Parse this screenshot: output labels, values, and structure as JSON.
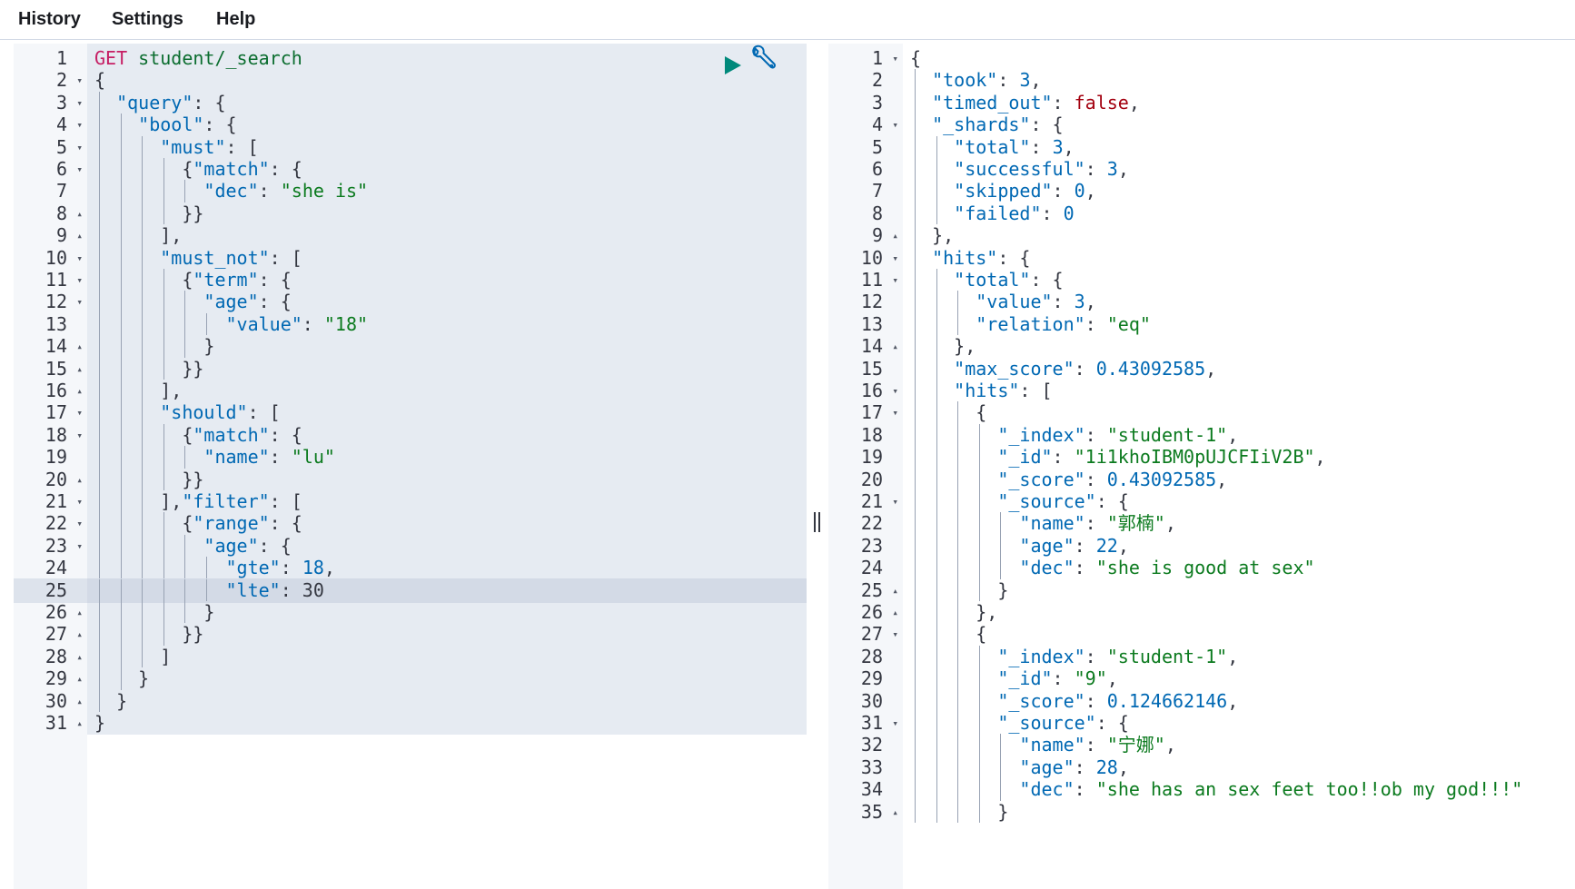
{
  "menu": {
    "history": "History",
    "settings": "Settings",
    "help": "Help"
  },
  "toolbar": {
    "run_icon": "play-icon",
    "settings_icon": "wrench-icon"
  },
  "colors": {
    "method": "#c61e64",
    "url": "#0b6d2f",
    "key": "#0068b3",
    "string": "#0b7a1e",
    "number": "#0068b3",
    "boolean": "#a3000f",
    "play_icon": "#00897b",
    "wrench_icon": "#0068b3"
  },
  "request": {
    "active_line": 25,
    "lines": [
      {
        "n": "1",
        "fold": "",
        "indent": 0,
        "tokens": [
          {
            "t": "method",
            "v": "GET"
          },
          {
            "t": "punc",
            "v": " "
          },
          {
            "t": "url",
            "v": "student/_search"
          }
        ]
      },
      {
        "n": "2",
        "fold": "▾",
        "indent": 0,
        "tokens": [
          {
            "t": "punc",
            "v": "{"
          }
        ]
      },
      {
        "n": "3",
        "fold": "▾",
        "indent": 1,
        "tokens": [
          {
            "t": "key",
            "v": "\"query\""
          },
          {
            "t": "punc",
            "v": ": {"
          }
        ]
      },
      {
        "n": "4",
        "fold": "▾",
        "indent": 2,
        "tokens": [
          {
            "t": "key",
            "v": "\"bool\""
          },
          {
            "t": "punc",
            "v": ": {"
          }
        ]
      },
      {
        "n": "5",
        "fold": "▾",
        "indent": 3,
        "tokens": [
          {
            "t": "key",
            "v": "\"must\""
          },
          {
            "t": "punc",
            "v": ": ["
          }
        ]
      },
      {
        "n": "6",
        "fold": "▾",
        "indent": 4,
        "tokens": [
          {
            "t": "punc",
            "v": "{"
          },
          {
            "t": "key",
            "v": "\"match\""
          },
          {
            "t": "punc",
            "v": ": {"
          }
        ]
      },
      {
        "n": "7",
        "fold": "",
        "indent": 5,
        "tokens": [
          {
            "t": "key",
            "v": "\"dec\""
          },
          {
            "t": "punc",
            "v": ": "
          },
          {
            "t": "str",
            "v": "\"she is\""
          }
        ]
      },
      {
        "n": "8",
        "fold": "▴",
        "indent": 4,
        "tokens": [
          {
            "t": "punc",
            "v": "}}"
          }
        ]
      },
      {
        "n": "9",
        "fold": "▴",
        "indent": 3,
        "tokens": [
          {
            "t": "punc",
            "v": "],"
          }
        ]
      },
      {
        "n": "10",
        "fold": "▾",
        "indent": 3,
        "tokens": [
          {
            "t": "key",
            "v": "\"must_not\""
          },
          {
            "t": "punc",
            "v": ": ["
          }
        ]
      },
      {
        "n": "11",
        "fold": "▾",
        "indent": 4,
        "tokens": [
          {
            "t": "punc",
            "v": "{"
          },
          {
            "t": "key",
            "v": "\"term\""
          },
          {
            "t": "punc",
            "v": ": {"
          }
        ]
      },
      {
        "n": "12",
        "fold": "▾",
        "indent": 5,
        "tokens": [
          {
            "t": "key",
            "v": "\"age\""
          },
          {
            "t": "punc",
            "v": ": {"
          }
        ]
      },
      {
        "n": "13",
        "fold": "",
        "indent": 6,
        "tokens": [
          {
            "t": "key",
            "v": "\"value\""
          },
          {
            "t": "punc",
            "v": ": "
          },
          {
            "t": "str",
            "v": "\"18\""
          }
        ]
      },
      {
        "n": "14",
        "fold": "▴",
        "indent": 5,
        "tokens": [
          {
            "t": "punc",
            "v": "}"
          }
        ]
      },
      {
        "n": "15",
        "fold": "▴",
        "indent": 4,
        "tokens": [
          {
            "t": "punc",
            "v": "}}"
          }
        ]
      },
      {
        "n": "16",
        "fold": "▴",
        "indent": 3,
        "tokens": [
          {
            "t": "punc",
            "v": "],"
          }
        ]
      },
      {
        "n": "17",
        "fold": "▾",
        "indent": 3,
        "tokens": [
          {
            "t": "key",
            "v": "\"should\""
          },
          {
            "t": "punc",
            "v": ": ["
          }
        ]
      },
      {
        "n": "18",
        "fold": "▾",
        "indent": 4,
        "tokens": [
          {
            "t": "punc",
            "v": "{"
          },
          {
            "t": "key",
            "v": "\"match\""
          },
          {
            "t": "punc",
            "v": ": {"
          }
        ]
      },
      {
        "n": "19",
        "fold": "",
        "indent": 5,
        "tokens": [
          {
            "t": "key",
            "v": "\"name\""
          },
          {
            "t": "punc",
            "v": ": "
          },
          {
            "t": "str",
            "v": "\"lu\""
          }
        ]
      },
      {
        "n": "20",
        "fold": "▴",
        "indent": 4,
        "tokens": [
          {
            "t": "punc",
            "v": "}}"
          }
        ]
      },
      {
        "n": "21",
        "fold": "▾",
        "indent": 3,
        "tokens": [
          {
            "t": "punc",
            "v": "],"
          },
          {
            "t": "key",
            "v": "\"filter\""
          },
          {
            "t": "punc",
            "v": ": ["
          }
        ]
      },
      {
        "n": "22",
        "fold": "▾",
        "indent": 4,
        "tokens": [
          {
            "t": "punc",
            "v": "{"
          },
          {
            "t": "key",
            "v": "\"range\""
          },
          {
            "t": "punc",
            "v": ": {"
          }
        ]
      },
      {
        "n": "23",
        "fold": "▾",
        "indent": 5,
        "tokens": [
          {
            "t": "key",
            "v": "\"age\""
          },
          {
            "t": "punc",
            "v": ": {"
          }
        ]
      },
      {
        "n": "24",
        "fold": "",
        "indent": 6,
        "tokens": [
          {
            "t": "key",
            "v": "\"gte\""
          },
          {
            "t": "punc",
            "v": ": "
          },
          {
            "t": "num",
            "v": "18"
          },
          {
            "t": "punc",
            "v": ","
          }
        ]
      },
      {
        "n": "25",
        "fold": "",
        "indent": 6,
        "tokens": [
          {
            "t": "key",
            "v": "\"lte\""
          },
          {
            "t": "sel",
            "v": ": 30"
          }
        ]
      },
      {
        "n": "26",
        "fold": "▴",
        "indent": 5,
        "tokens": [
          {
            "t": "punc",
            "v": "}"
          }
        ]
      },
      {
        "n": "27",
        "fold": "▴",
        "indent": 4,
        "tokens": [
          {
            "t": "punc",
            "v": "}}"
          }
        ]
      },
      {
        "n": "28",
        "fold": "▴",
        "indent": 3,
        "tokens": [
          {
            "t": "punc",
            "v": "]"
          }
        ]
      },
      {
        "n": "29",
        "fold": "▴",
        "indent": 2,
        "tokens": [
          {
            "t": "punc",
            "v": "}"
          }
        ]
      },
      {
        "n": "30",
        "fold": "▴",
        "indent": 1,
        "tokens": [
          {
            "t": "punc",
            "v": "}"
          }
        ]
      },
      {
        "n": "31",
        "fold": "▴",
        "indent": 0,
        "tokens": [
          {
            "t": "punc",
            "v": "}"
          }
        ]
      }
    ]
  },
  "response": {
    "lines": [
      {
        "n": "1",
        "fold": "▾",
        "indent": 0,
        "tokens": [
          {
            "t": "punc",
            "v": "{"
          }
        ]
      },
      {
        "n": "2",
        "fold": "",
        "indent": 1,
        "tokens": [
          {
            "t": "key",
            "v": "\"took\""
          },
          {
            "t": "punc",
            "v": ": "
          },
          {
            "t": "num",
            "v": "3"
          },
          {
            "t": "punc",
            "v": ","
          }
        ]
      },
      {
        "n": "3",
        "fold": "",
        "indent": 1,
        "tokens": [
          {
            "t": "key",
            "v": "\"timed_out\""
          },
          {
            "t": "punc",
            "v": ": "
          },
          {
            "t": "bool",
            "v": "false"
          },
          {
            "t": "punc",
            "v": ","
          }
        ]
      },
      {
        "n": "4",
        "fold": "▾",
        "indent": 1,
        "tokens": [
          {
            "t": "key",
            "v": "\"_shards\""
          },
          {
            "t": "punc",
            "v": ": {"
          }
        ]
      },
      {
        "n": "5",
        "fold": "",
        "indent": 2,
        "tokens": [
          {
            "t": "key",
            "v": "\"total\""
          },
          {
            "t": "punc",
            "v": ": "
          },
          {
            "t": "num",
            "v": "3"
          },
          {
            "t": "punc",
            "v": ","
          }
        ]
      },
      {
        "n": "6",
        "fold": "",
        "indent": 2,
        "tokens": [
          {
            "t": "key",
            "v": "\"successful\""
          },
          {
            "t": "punc",
            "v": ": "
          },
          {
            "t": "num",
            "v": "3"
          },
          {
            "t": "punc",
            "v": ","
          }
        ]
      },
      {
        "n": "7",
        "fold": "",
        "indent": 2,
        "tokens": [
          {
            "t": "key",
            "v": "\"skipped\""
          },
          {
            "t": "punc",
            "v": ": "
          },
          {
            "t": "num",
            "v": "0"
          },
          {
            "t": "punc",
            "v": ","
          }
        ]
      },
      {
        "n": "8",
        "fold": "",
        "indent": 2,
        "tokens": [
          {
            "t": "key",
            "v": "\"failed\""
          },
          {
            "t": "punc",
            "v": ": "
          },
          {
            "t": "num",
            "v": "0"
          }
        ]
      },
      {
        "n": "9",
        "fold": "▴",
        "indent": 1,
        "tokens": [
          {
            "t": "punc",
            "v": "},"
          }
        ]
      },
      {
        "n": "10",
        "fold": "▾",
        "indent": 1,
        "tokens": [
          {
            "t": "key",
            "v": "\"hits\""
          },
          {
            "t": "punc",
            "v": ": {"
          }
        ]
      },
      {
        "n": "11",
        "fold": "▾",
        "indent": 2,
        "tokens": [
          {
            "t": "key",
            "v": "\"total\""
          },
          {
            "t": "punc",
            "v": ": {"
          }
        ]
      },
      {
        "n": "12",
        "fold": "",
        "indent": 3,
        "tokens": [
          {
            "t": "key",
            "v": "\"value\""
          },
          {
            "t": "punc",
            "v": ": "
          },
          {
            "t": "num",
            "v": "3"
          },
          {
            "t": "punc",
            "v": ","
          }
        ]
      },
      {
        "n": "13",
        "fold": "",
        "indent": 3,
        "tokens": [
          {
            "t": "key",
            "v": "\"relation\""
          },
          {
            "t": "punc",
            "v": ": "
          },
          {
            "t": "str",
            "v": "\"eq\""
          }
        ]
      },
      {
        "n": "14",
        "fold": "▴",
        "indent": 2,
        "tokens": [
          {
            "t": "punc",
            "v": "},"
          }
        ]
      },
      {
        "n": "15",
        "fold": "",
        "indent": 2,
        "tokens": [
          {
            "t": "key",
            "v": "\"max_score\""
          },
          {
            "t": "punc",
            "v": ": "
          },
          {
            "t": "num",
            "v": "0.43092585"
          },
          {
            "t": "punc",
            "v": ","
          }
        ]
      },
      {
        "n": "16",
        "fold": "▾",
        "indent": 2,
        "tokens": [
          {
            "t": "key",
            "v": "\"hits\""
          },
          {
            "t": "punc",
            "v": ": ["
          }
        ]
      },
      {
        "n": "17",
        "fold": "▾",
        "indent": 3,
        "tokens": [
          {
            "t": "punc",
            "v": "{"
          }
        ]
      },
      {
        "n": "18",
        "fold": "",
        "indent": 4,
        "tokens": [
          {
            "t": "key",
            "v": "\"_index\""
          },
          {
            "t": "punc",
            "v": ": "
          },
          {
            "t": "str",
            "v": "\"student-1\""
          },
          {
            "t": "punc",
            "v": ","
          }
        ]
      },
      {
        "n": "19",
        "fold": "",
        "indent": 4,
        "tokens": [
          {
            "t": "key",
            "v": "\"_id\""
          },
          {
            "t": "punc",
            "v": ": "
          },
          {
            "t": "str",
            "v": "\"1i1khoIBM0pUJCFIiV2B\""
          },
          {
            "t": "punc",
            "v": ","
          }
        ]
      },
      {
        "n": "20",
        "fold": "",
        "indent": 4,
        "tokens": [
          {
            "t": "key",
            "v": "\"_score\""
          },
          {
            "t": "punc",
            "v": ": "
          },
          {
            "t": "num",
            "v": "0.43092585"
          },
          {
            "t": "punc",
            "v": ","
          }
        ]
      },
      {
        "n": "21",
        "fold": "▾",
        "indent": 4,
        "tokens": [
          {
            "t": "key",
            "v": "\"_source\""
          },
          {
            "t": "punc",
            "v": ": {"
          }
        ]
      },
      {
        "n": "22",
        "fold": "",
        "indent": 5,
        "tokens": [
          {
            "t": "key",
            "v": "\"name\""
          },
          {
            "t": "punc",
            "v": ": "
          },
          {
            "t": "str",
            "v": "\"郭楠\""
          },
          {
            "t": "punc",
            "v": ","
          }
        ]
      },
      {
        "n": "23",
        "fold": "",
        "indent": 5,
        "tokens": [
          {
            "t": "key",
            "v": "\"age\""
          },
          {
            "t": "punc",
            "v": ": "
          },
          {
            "t": "num",
            "v": "22"
          },
          {
            "t": "punc",
            "v": ","
          }
        ]
      },
      {
        "n": "24",
        "fold": "",
        "indent": 5,
        "tokens": [
          {
            "t": "key",
            "v": "\"dec\""
          },
          {
            "t": "punc",
            "v": ": "
          },
          {
            "t": "str",
            "v": "\"she is good at sex\""
          }
        ]
      },
      {
        "n": "25",
        "fold": "▴",
        "indent": 4,
        "tokens": [
          {
            "t": "punc",
            "v": "}"
          }
        ]
      },
      {
        "n": "26",
        "fold": "▴",
        "indent": 3,
        "tokens": [
          {
            "t": "punc",
            "v": "},"
          }
        ]
      },
      {
        "n": "27",
        "fold": "▾",
        "indent": 3,
        "tokens": [
          {
            "t": "punc",
            "v": "{"
          }
        ]
      },
      {
        "n": "28",
        "fold": "",
        "indent": 4,
        "tokens": [
          {
            "t": "key",
            "v": "\"_index\""
          },
          {
            "t": "punc",
            "v": ": "
          },
          {
            "t": "str",
            "v": "\"student-1\""
          },
          {
            "t": "punc",
            "v": ","
          }
        ]
      },
      {
        "n": "29",
        "fold": "",
        "indent": 4,
        "tokens": [
          {
            "t": "key",
            "v": "\"_id\""
          },
          {
            "t": "punc",
            "v": ": "
          },
          {
            "t": "str",
            "v": "\"9\""
          },
          {
            "t": "punc",
            "v": ","
          }
        ]
      },
      {
        "n": "30",
        "fold": "",
        "indent": 4,
        "tokens": [
          {
            "t": "key",
            "v": "\"_score\""
          },
          {
            "t": "punc",
            "v": ": "
          },
          {
            "t": "num",
            "v": "0.124662146"
          },
          {
            "t": "punc",
            "v": ","
          }
        ]
      },
      {
        "n": "31",
        "fold": "▾",
        "indent": 4,
        "tokens": [
          {
            "t": "key",
            "v": "\"_source\""
          },
          {
            "t": "punc",
            "v": ": {"
          }
        ]
      },
      {
        "n": "32",
        "fold": "",
        "indent": 5,
        "tokens": [
          {
            "t": "key",
            "v": "\"name\""
          },
          {
            "t": "punc",
            "v": ": "
          },
          {
            "t": "str",
            "v": "\"宁娜\""
          },
          {
            "t": "punc",
            "v": ","
          }
        ]
      },
      {
        "n": "33",
        "fold": "",
        "indent": 5,
        "tokens": [
          {
            "t": "key",
            "v": "\"age\""
          },
          {
            "t": "punc",
            "v": ": "
          },
          {
            "t": "num",
            "v": "28"
          },
          {
            "t": "punc",
            "v": ","
          }
        ]
      },
      {
        "n": "34",
        "fold": "",
        "indent": 5,
        "tokens": [
          {
            "t": "key",
            "v": "\"dec\""
          },
          {
            "t": "punc",
            "v": ": "
          },
          {
            "t": "str",
            "v": "\"she has an sex feet too!!ob my god!!!\""
          }
        ]
      },
      {
        "n": "35",
        "fold": "▴",
        "indent": 4,
        "tokens": [
          {
            "t": "punc",
            "v": "}"
          }
        ]
      }
    ]
  }
}
